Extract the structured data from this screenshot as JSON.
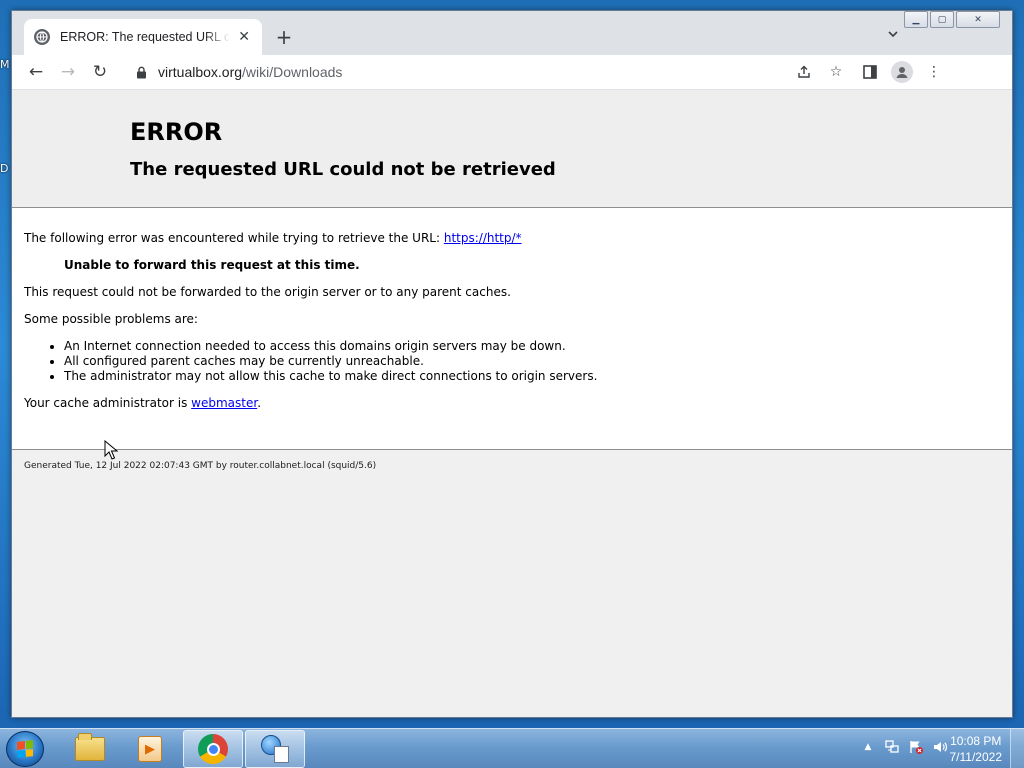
{
  "desktop": {
    "edge_fragments": [
      "M",
      "D"
    ]
  },
  "browser": {
    "tab": {
      "title": "ERROR: The requested URL could not be retrieved",
      "favicon": "globe-icon",
      "close_glyph": "✕"
    },
    "new_tab_glyph": "+",
    "tab_search_glyph": "⌄",
    "window_controls": {
      "minimize_glyph": "▁",
      "maximize_glyph": "▢",
      "close_glyph": "✕"
    },
    "toolbar": {
      "back_glyph": "←",
      "forward_glyph": "→",
      "reload_glyph": "↻",
      "lock_glyph": "🔒",
      "url_host": "virtualbox.org",
      "url_path": "/wiki/Downloads",
      "share_glyph": "⇪",
      "bookmark_glyph": "☆",
      "sidepanel_glyph": "◧",
      "profile_glyph": "👤",
      "menu_glyph": "⋮"
    }
  },
  "page": {
    "title": "ERROR",
    "subtitle": "The requested URL could not be retrieved",
    "intro_text": "The following error was encountered while trying to retrieve the URL: ",
    "intro_link": "https://http/*",
    "error_reason": "Unable to forward this request at this time.",
    "explanation": "This request could not be forwarded to the origin server or to any parent caches.",
    "problems_heading": "Some possible problems are:",
    "problems": [
      "An Internet connection needed to access this domains origin servers may be down.",
      "All configured parent caches may be currently unreachable.",
      "The administrator may not allow this cache to make direct connections to origin servers."
    ],
    "admin_text": "Your cache administrator is ",
    "admin_link": "webmaster",
    "admin_suffix": ".",
    "footer": "Generated Tue, 12 Jul 2022 02:07:43 GMT by router.collabnet.local (squid/5.6)"
  },
  "taskbar": {
    "apps": [
      {
        "name": "windows-explorer",
        "icon": "folder-icon",
        "active": false
      },
      {
        "name": "windows-media-player",
        "icon": "media-player-icon",
        "active": false
      },
      {
        "name": "google-chrome",
        "icon": "chrome-icon",
        "active": true
      },
      {
        "name": "network-app",
        "icon": "network-icon",
        "active": true
      }
    ],
    "tray": {
      "show_hidden_glyph": "▲",
      "network_glyph": "🖧",
      "action_center_glyph": "⚑",
      "volume_glyph": "🔊"
    },
    "clock": {
      "time": "10:08 PM",
      "date": "7/11/2022"
    }
  }
}
